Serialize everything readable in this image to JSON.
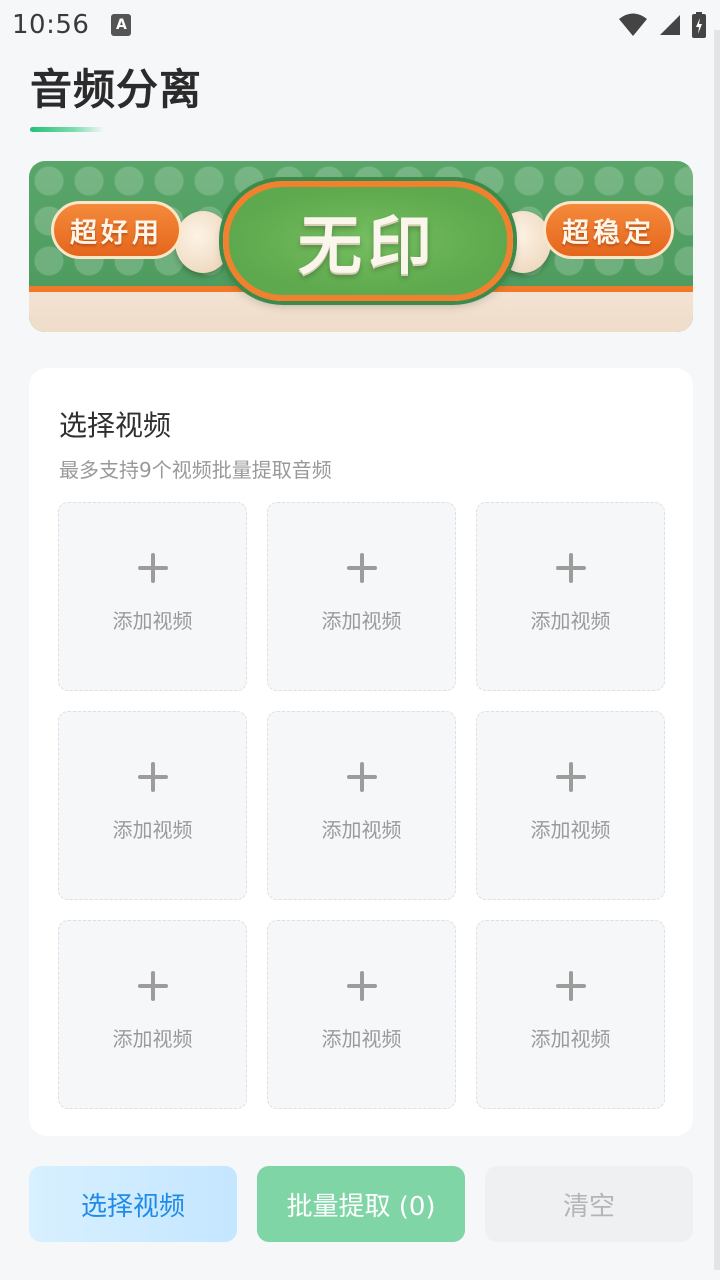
{
  "status_bar": {
    "time": "10:56",
    "notification_icon": "A"
  },
  "page": {
    "title": "音频分离",
    "accent_color": "#22c07a"
  },
  "banner": {
    "left_tag": "超好用",
    "center_text": "无印",
    "right_tag": "超稳定"
  },
  "card": {
    "title": "选择视频",
    "subtitle": "最多支持9个视频批量提取音频",
    "slots": [
      {
        "label": "添加视频"
      },
      {
        "label": "添加视频"
      },
      {
        "label": "添加视频"
      },
      {
        "label": "添加视频"
      },
      {
        "label": "添加视频"
      },
      {
        "label": "添加视频"
      },
      {
        "label": "添加视频"
      },
      {
        "label": "添加视频"
      },
      {
        "label": "添加视频"
      }
    ]
  },
  "actions": {
    "select_label": "选择视频",
    "extract_label": "批量提取 (0)",
    "clear_label": "清空"
  }
}
